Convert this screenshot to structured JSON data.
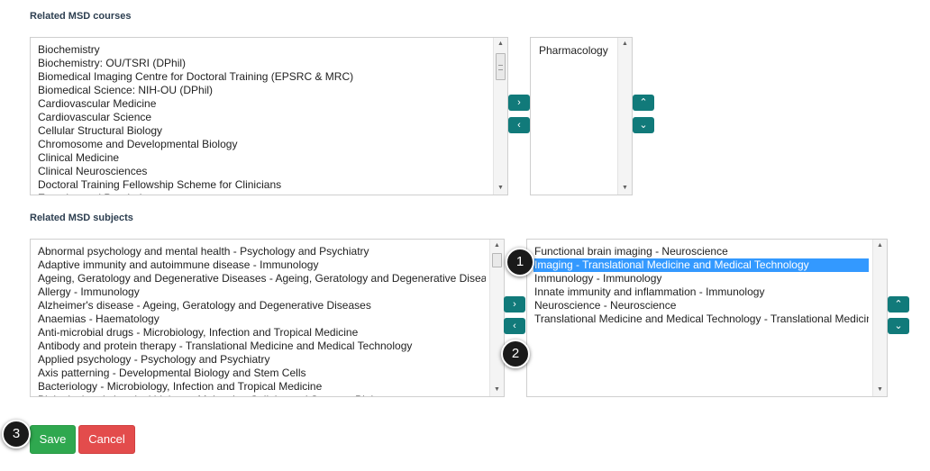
{
  "courses": {
    "title": "Related MSD courses",
    "available": [
      "Biochemistry",
      "Biochemistry: OU/TSRI (DPhil)",
      "Biomedical Imaging Centre for Doctoral Training (EPSRC & MRC)",
      "Biomedical Science: NIH-OU (DPhil)",
      "Cardiovascular Medicine",
      "Cardiovascular Science",
      "Cellular Structural Biology",
      "Chromosome and Developmental Biology",
      "Clinical Medicine",
      "Clinical Neurosciences",
      "Doctoral Training Fellowship Scheme for Clinicians",
      "Experimental Psychology"
    ],
    "selected": [
      "Pharmacology"
    ]
  },
  "subjects": {
    "title": "Related MSD subjects",
    "available": [
      "Abnormal psychology and mental health - Psychology and Psychiatry",
      "Adaptive immunity and autoimmune disease - Immunology",
      "Ageing, Geratology and Degenerative Diseases - Ageing, Geratology and Degenerative Diseases",
      "Allergy - Immunology",
      "Alzheimer's disease - Ageing, Geratology and Degenerative Diseases",
      "Anaemias - Haematology",
      "Anti-microbial drugs - Microbiology, Infection and Tropical Medicine",
      "Antibody and protein therapy - Translational Medicine and Medical Technology",
      "Applied psychology - Psychology and Psychiatry",
      "Axis patterning - Developmental Biology and Stem Cells",
      "Bacteriology - Microbiology, Infection and Tropical Medicine",
      "Biological and chemical biology - Molecular, Cellular and Systems Biology"
    ],
    "selected": [
      "Functional brain imaging - Neuroscience",
      "Imaging - Translational Medicine and Medical Technology",
      "Immunology - Immunology",
      "Innate immunity and inflammation - Immunology",
      "Neuroscience - Neuroscience",
      "Translational Medicine and Medical Technology - Translational Medicine and Medical Technology"
    ],
    "highlighted_index": 1
  },
  "icons": {
    "move_right": "›",
    "move_left": "‹",
    "move_up": "⌃",
    "move_down": "⌄",
    "scroll_up": "▲",
    "scroll_down": "▼"
  },
  "buttons": {
    "save": "Save",
    "cancel": "Cancel"
  },
  "markers": [
    "1",
    "2",
    "3"
  ],
  "colors": {
    "teal": "#117a7a",
    "save": "#2fa84f",
    "cancel": "#e34c4c",
    "highlight": "#3399ff"
  }
}
